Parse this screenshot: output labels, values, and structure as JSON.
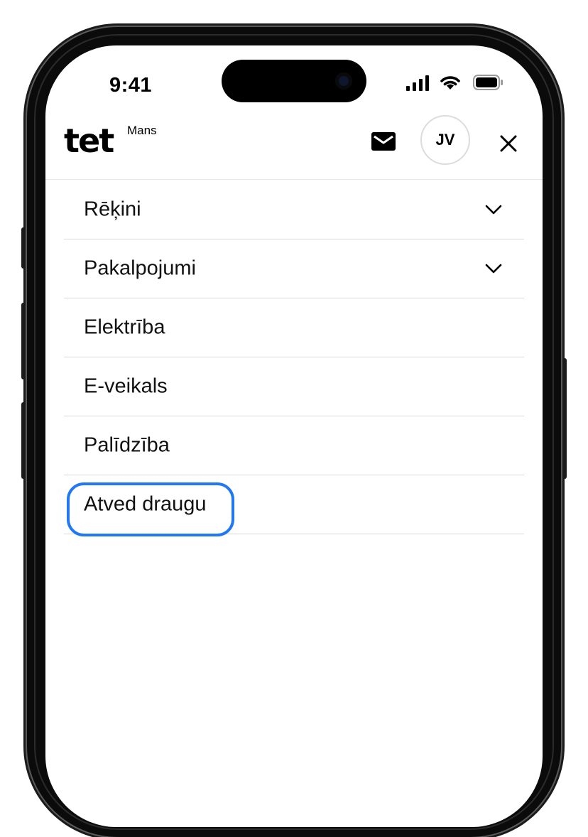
{
  "status_bar": {
    "time": "9:41",
    "icons": [
      "cellular-signal-icon",
      "wifi-icon",
      "battery-icon"
    ]
  },
  "header": {
    "logo_text": "tet",
    "logo_suffix": "Mans",
    "mail_icon": "mail-icon",
    "avatar_initials": "JV",
    "close_icon": "close-icon"
  },
  "menu": {
    "items": [
      {
        "label": "Rēķini",
        "expandable": true
      },
      {
        "label": "Pakalpojumi",
        "expandable": true
      },
      {
        "label": "Elektrība",
        "expandable": false
      },
      {
        "label": "E-veikals",
        "expandable": false
      },
      {
        "label": "Palīdzība",
        "expandable": false
      },
      {
        "label": "Atved draugu",
        "expandable": false,
        "highlighted": true
      }
    ]
  },
  "colors": {
    "highlight": "#2277f2",
    "text": "#111111",
    "divider": "#d8d8d8",
    "frame": "#0b0b0b"
  }
}
